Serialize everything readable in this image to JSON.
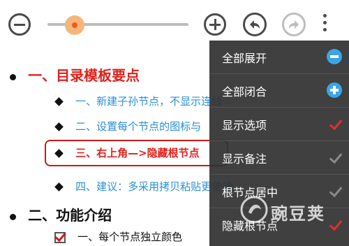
{
  "toolbar": {
    "zoom_out": "zoom-out",
    "zoom_in": "zoom-in",
    "undo": "undo",
    "redo": "redo",
    "more": "more",
    "zoom_slider_fraction": 0.12
  },
  "outline": {
    "section1": "一、目录模板要点",
    "items1": [
      "一、新建子孙节点，不显示连线",
      "二、设置每个节点的图标与",
      "三、右上角—>隐藏根节点",
      "四、建议：多采用拷贝粘贴更便捷"
    ],
    "section2": "二、功能介绍",
    "items2": [
      "一、每个节点独立颜色"
    ]
  },
  "menu": {
    "items": [
      {
        "label": "全部展开",
        "icon": "minus-circle-icon"
      },
      {
        "label": "全部闭合",
        "icon": "plus-circle-icon"
      },
      {
        "label": "显示选项",
        "check": "red"
      },
      {
        "label": "显示备注",
        "check": "gray"
      },
      {
        "label": "根节点居中",
        "check": "gray"
      },
      {
        "label": "隐藏根节点",
        "check": "red"
      }
    ]
  },
  "watermark": {
    "text": "豌豆荚"
  },
  "colors": {
    "accent_red": "#e0201b",
    "link_blue": "#2a8fd6",
    "menu_bg": "#323232",
    "icon_blue": "#3aa6e8"
  }
}
